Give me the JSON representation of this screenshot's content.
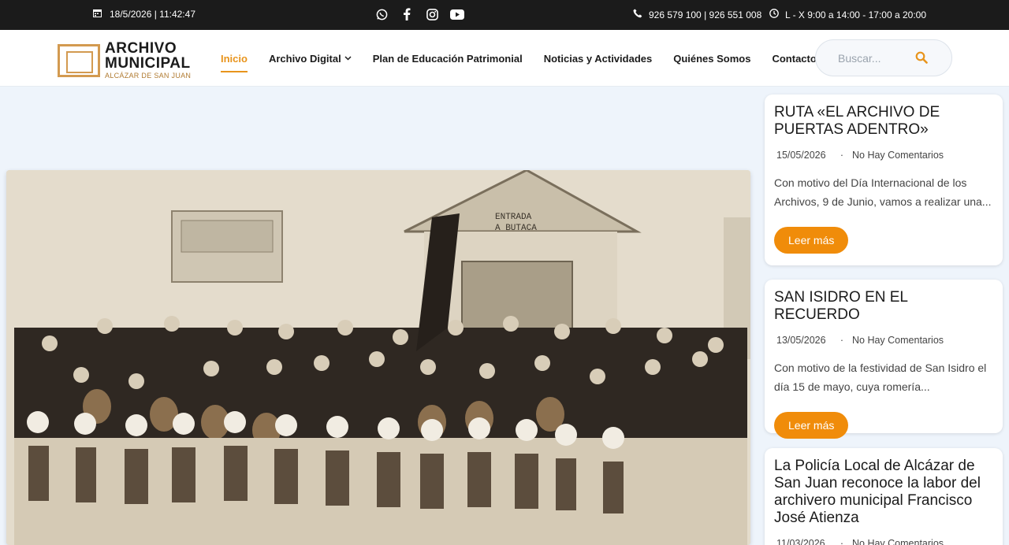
{
  "topbar": {
    "datetime": "18/5/2026 | 11:42:47",
    "phone": "926 579 100 | 926 551 008",
    "hours": "L - X 9:00 a 14:00 - 17:00 a 20:00",
    "social": [
      "whatsapp-icon",
      "facebook-icon",
      "instagram-icon",
      "youtube-icon"
    ]
  },
  "logo": {
    "line1": "ARCHIVO",
    "line2": "MUNICIPAL",
    "line3": "ALCÁZAR DE SAN JUAN"
  },
  "nav": {
    "items": [
      {
        "label": "Inicio"
      },
      {
        "label": "Archivo Digital"
      },
      {
        "label": "Plan de Educación Patrimonial"
      },
      {
        "label": "Noticias y Actividades"
      },
      {
        "label": "Quiénes Somos"
      },
      {
        "label": "Contacto"
      }
    ]
  },
  "search": {
    "placeholder": "Buscar..."
  },
  "posts": [
    {
      "title": "RUTA «EL ARCHIVO DE PUERTAS ADENTRO»",
      "date": "15/05/2026",
      "separator": "·",
      "comments": "No Hay Comentarios",
      "excerpt": "Con motivo del Día Internacional de los Archivos, 9 de Junio, vamos a realizar una...",
      "button": "Leer más"
    },
    {
      "title": "SAN ISIDRO EN EL RECUERDO",
      "date": "13/05/2026",
      "separator": "·",
      "comments": "No Hay Comentarios",
      "excerpt": "Con motivo de la festividad de San Isidro el día 15 de mayo, cuya romería...",
      "button": "Leer más"
    },
    {
      "title": "La Policía Local de Alcázar de San Juan reconoce la labor del archivero municipal Francisco José Atienza",
      "date": "11/03/2026",
      "separator": "·",
      "comments": "No Hay Comentarios"
    }
  ],
  "hero": {
    "sign_line1": "ENTRADA",
    "sign_line2": "A BUTACA"
  },
  "colors": {
    "accent": "#f08c0a",
    "topbar": "#1b1b1b"
  }
}
